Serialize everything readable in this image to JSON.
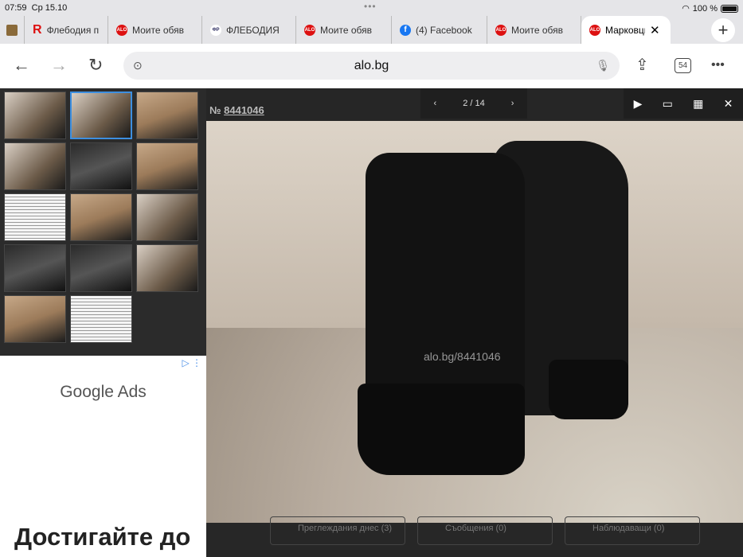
{
  "status": {
    "time": "07:59",
    "date": "Ср 15.10",
    "battery": "100 %"
  },
  "tabs": [
    {
      "label": "Флебодия п",
      "icon": "R"
    },
    {
      "label": "Моите обяв",
      "icon": "ALO"
    },
    {
      "label": "ФЛЕБОДИЯ",
      "icon": "ФР"
    },
    {
      "label": "Моите обяв",
      "icon": "ALO"
    },
    {
      "label": "(4) Facebook",
      "icon": "f"
    },
    {
      "label": "Моите обяв",
      "icon": "ALO"
    },
    {
      "label": "Марковци",
      "icon": "ALO",
      "active": true
    }
  ],
  "toolbar": {
    "url": "alo.bg",
    "tab_count": "54"
  },
  "viewer": {
    "ad_number_prefix": "№",
    "ad_number": "8441046",
    "counter": "2 / 14",
    "watermark": "alo.bg/8441046"
  },
  "ad": {
    "brand": "Google Ads",
    "headline": "Достигайте до"
  },
  "stats": {
    "views": "Преглеждания днес (3)",
    "messages": "Съобщения (0)",
    "watchers": "Наблюдаващи (0)"
  }
}
